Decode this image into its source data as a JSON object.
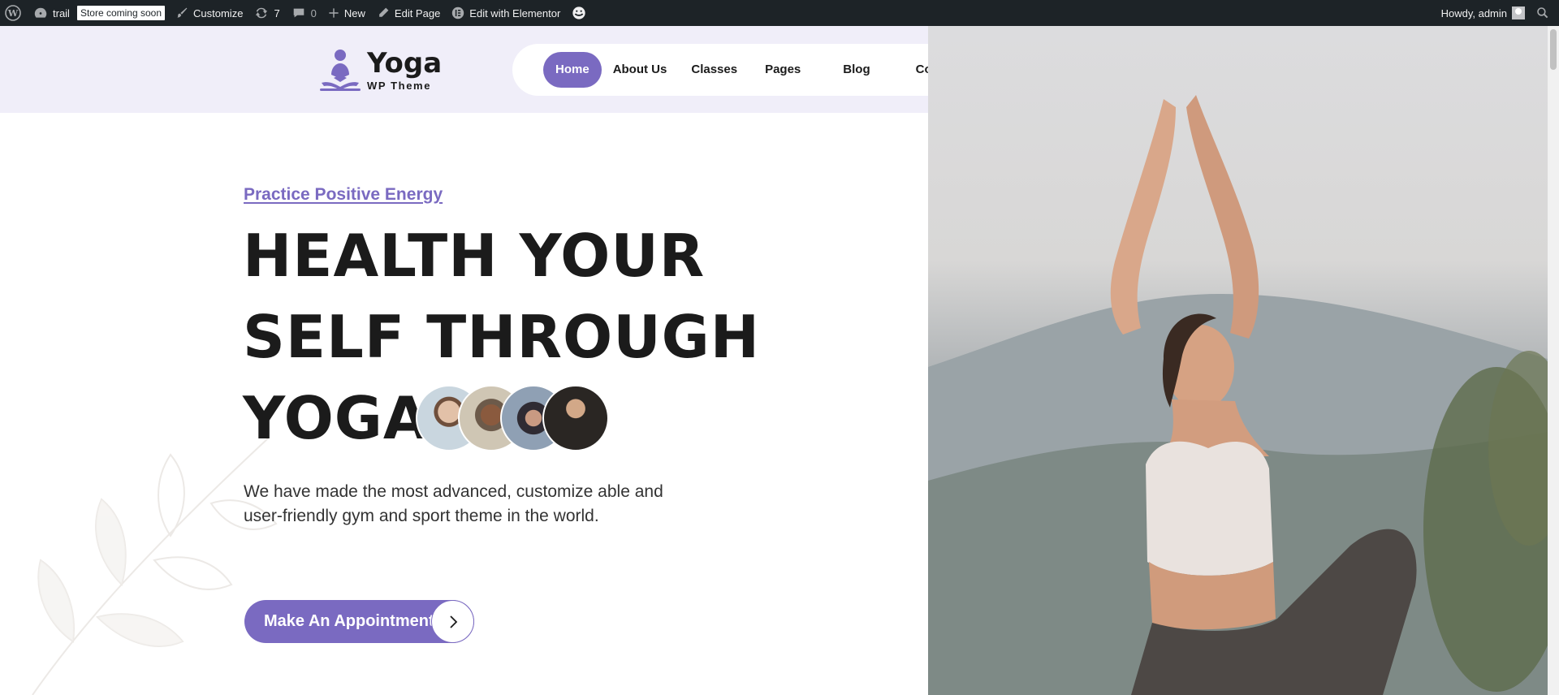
{
  "admin_bar": {
    "site_name": "trail",
    "store_badge": "Store coming soon",
    "customize": "Customize",
    "updates_count": "7",
    "comments_count": "0",
    "new": "New",
    "edit_page": "Edit Page",
    "edit_elementor": "Edit with Elementor",
    "greeting": "Howdy, admin"
  },
  "logo": {
    "title": "Yoga",
    "subtitle": "WP Theme"
  },
  "nav": {
    "items": [
      {
        "label": "Home",
        "active": true
      },
      {
        "label": "About Us"
      },
      {
        "label": "Classes"
      },
      {
        "label": "Pages"
      },
      {
        "label": "Blog"
      },
      {
        "label": "Contact Us"
      }
    ]
  },
  "header_icons": [
    "user-icon",
    "cart-icon"
  ],
  "hero": {
    "tagline": "Practice Positive Energy",
    "headline_lines": [
      "HEALTH YOUR",
      "SELF THROUGH",
      "YOGA"
    ],
    "description": "We have made the most advanced, customize able and user-friendly gym and sport theme in the world.",
    "cta_label": "Make An Appointment"
  },
  "colors": {
    "accent": "#7a6ac1",
    "header_bg": "#f0eef9",
    "admin_bar": "#1d2327",
    "text": "#1b1b1b"
  }
}
